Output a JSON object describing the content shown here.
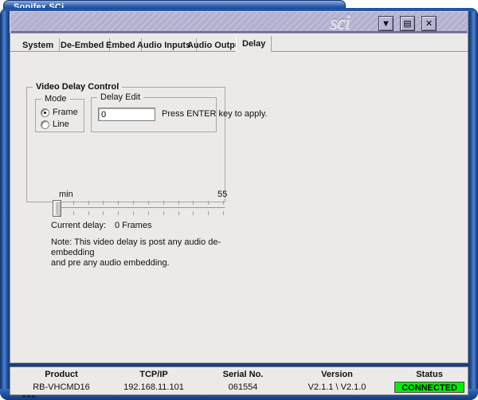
{
  "window": {
    "title": "Sonifex SCi",
    "logo_text": "sci",
    "controls": [
      {
        "name": "minimize",
        "label": "Minimize",
        "glyph": "▼"
      },
      {
        "name": "restore",
        "label": "Restore",
        "glyph": "▤"
      },
      {
        "name": "close",
        "label": "Close",
        "glyph": "✕"
      }
    ]
  },
  "tabs": [
    {
      "label": "System",
      "active": false
    },
    {
      "label": "De-Embed",
      "active": false
    },
    {
      "label": "Embed",
      "active": false
    },
    {
      "label": "Audio Inputs",
      "active": false
    },
    {
      "label": "Audio Outputs",
      "active": false
    },
    {
      "label": "Delay",
      "active": true
    }
  ],
  "delay_panel": {
    "group_title": "Video Delay Control",
    "mode": {
      "group_title": "Mode",
      "options": [
        {
          "label": "Frame",
          "checked": true
        },
        {
          "label": "Line",
          "checked": false
        }
      ]
    },
    "delay_edit": {
      "group_title": "Delay Edit",
      "value": "0",
      "placeholder": "",
      "hint": "Press ENTER key to apply."
    },
    "slider": {
      "min_label": "min",
      "max_label": "55",
      "min": 0,
      "max": 55,
      "value": 0,
      "tick_count": 12
    },
    "current_delay": {
      "label": "Current delay:",
      "value": "0 Frames"
    },
    "note": "Note: This video delay is post any audio de-embedding\nand pre any audio embedding."
  },
  "status_bar": {
    "product": {
      "label": "Product",
      "value": "RB-VHCMD16"
    },
    "tcpip": {
      "label": "TCP/IP",
      "value": "192.168.11.101"
    },
    "serial": {
      "label": "Serial No.",
      "value": "061554"
    },
    "version": {
      "label": "Version",
      "value": "V2.1.1 \\ V2.1.0"
    },
    "status": {
      "label": "Status",
      "value": "CONNECTED",
      "color": "#00f000"
    }
  }
}
